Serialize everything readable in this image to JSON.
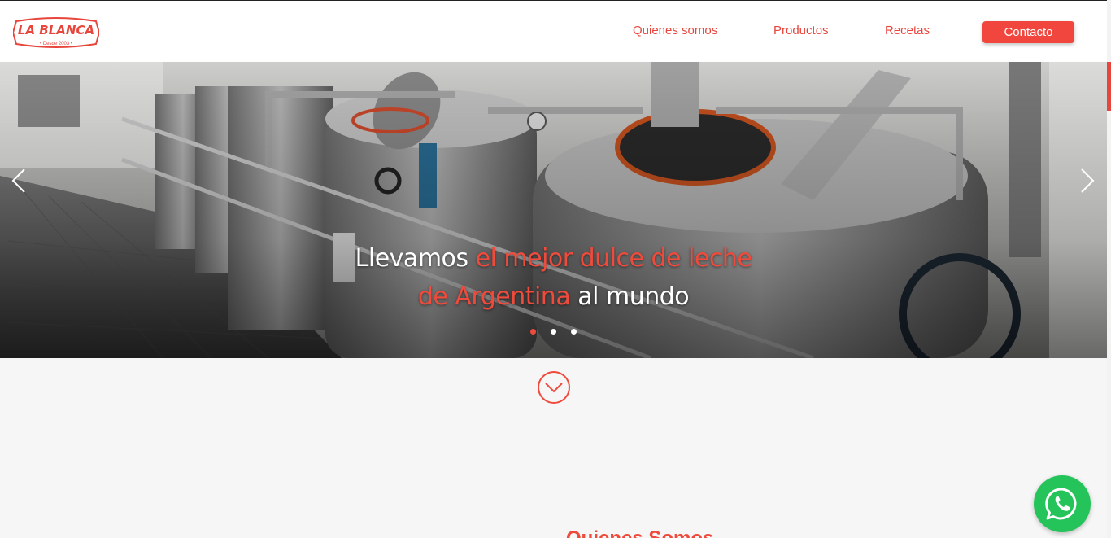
{
  "brand": {
    "name": "LA BLANCA",
    "tagline": "• Desde 2003 •",
    "color": "#e8453c"
  },
  "nav": {
    "items": [
      {
        "label": "Quienes somos"
      },
      {
        "label": "Productos"
      },
      {
        "label": "Recetas"
      }
    ],
    "contact_label": "Contacto"
  },
  "hero": {
    "title_part1": "Llevamos ",
    "title_accent1": "el mejor dulce de leche",
    "title_accent2": "de Argentina",
    "title_part2": " al mundo",
    "slides_total": 3,
    "active_slide": 1,
    "prev_icon": "chevron-left-icon",
    "next_icon": "chevron-right-icon"
  },
  "scroll_down": {
    "icon": "chevron-down-circle-icon"
  },
  "section": {
    "heading": "Quienes Somos"
  },
  "whatsapp": {
    "icon": "whatsapp-icon",
    "color": "#25c45a"
  }
}
